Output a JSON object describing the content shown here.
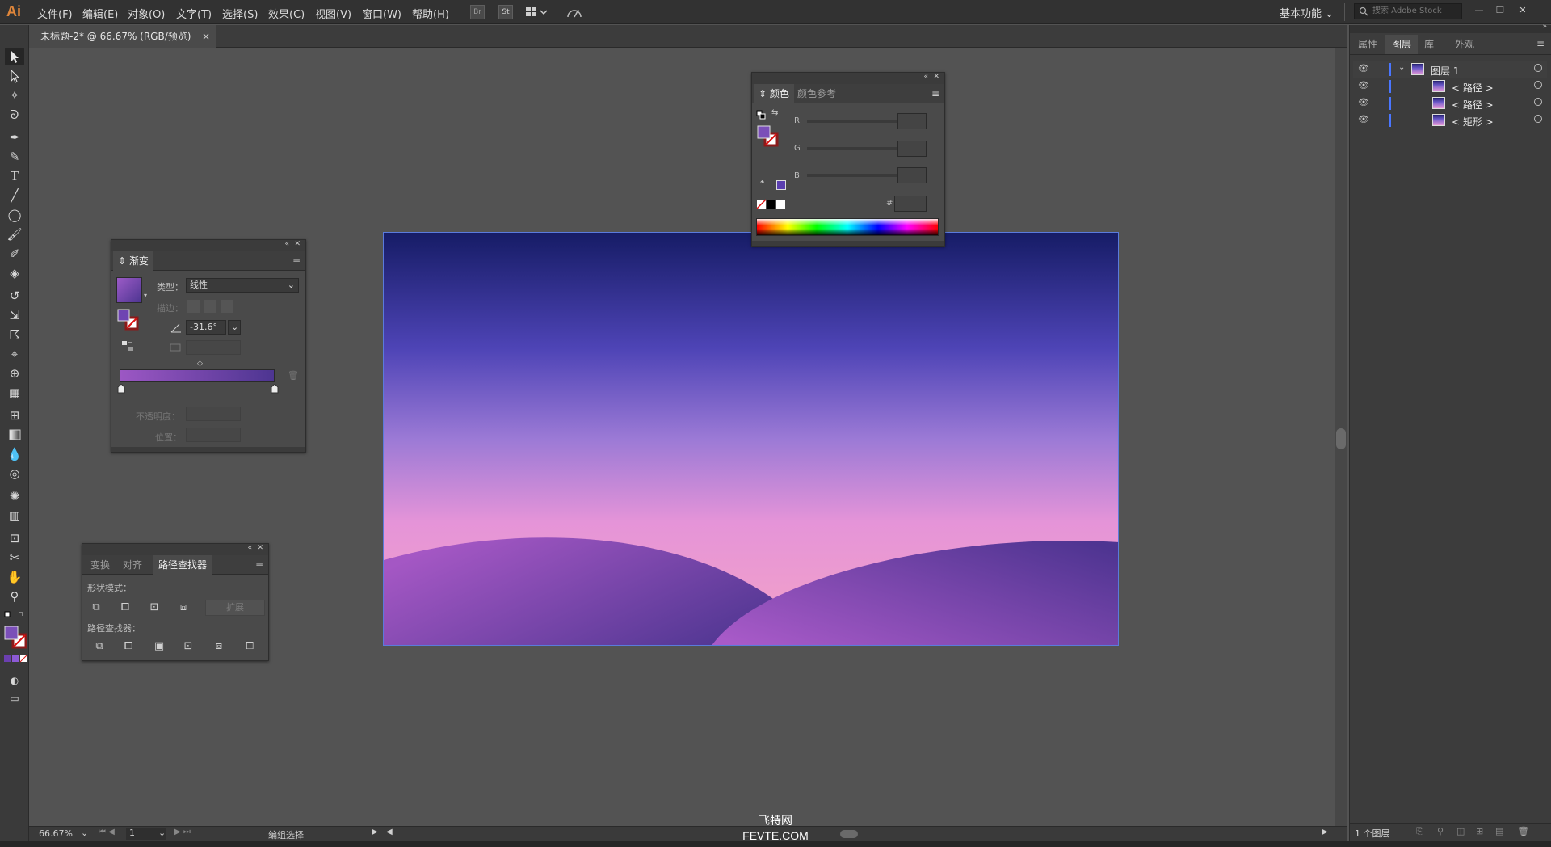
{
  "app": {
    "logo": "Ai"
  },
  "menu": [
    "文件(F)",
    "编辑(E)",
    "对象(O)",
    "文字(T)",
    "选择(S)",
    "效果(C)",
    "视图(V)",
    "窗口(W)",
    "帮助(H)"
  ],
  "menu_icons": {
    "bridge": "Br",
    "stock": "St"
  },
  "workspace": "基本功能",
  "search_placeholder": "搜索 Adobe Stock",
  "doc_tab": {
    "title": "未标题-2* @ 66.67% (RGB/预览)",
    "close": "×"
  },
  "tools": [
    "selection-arrow",
    "direct-selection",
    "magic-wand",
    "lasso",
    "pen",
    "curvature-pen",
    "type",
    "line-segment",
    "ellipse",
    "paintbrush",
    "shaper",
    "eraser",
    "rotate",
    "scale",
    "warp",
    "free-transform",
    "shape-builder",
    "perspective-grid",
    "mesh",
    "gradient",
    "eyedropper",
    "blend",
    "symbol-sprayer",
    "column-graph",
    "artboard",
    "slice",
    "hand",
    "zoom"
  ],
  "gradient_panel": {
    "tab": "渐变",
    "type_label": "类型：",
    "type_value": "线性",
    "stroke_label": "描边：",
    "angle_value": "-31.6°",
    "opacity_label": "不透明度：",
    "position_label": "位置："
  },
  "color_panel": {
    "tabs": [
      "颜色",
      "颜色参考"
    ],
    "channels": [
      "R",
      "G",
      "B"
    ],
    "hash": "#"
  },
  "pathfinder_panel": {
    "tabs": [
      "变换",
      "对齐",
      "路径查找器"
    ],
    "shape_modes_label": "形状模式：",
    "expand_label": "扩展",
    "pathfinders_label": "路径查找器："
  },
  "right_panel": {
    "tabs": [
      "属性",
      "图层",
      "库",
      "外观"
    ],
    "layers": [
      {
        "name": "图层 1"
      },
      {
        "name": "< 路径 >"
      },
      {
        "name": "< 路径 >"
      },
      {
        "name": "< 矩形 >"
      }
    ],
    "footer_count": "1 个图层"
  },
  "status": {
    "zoom": "66.67%",
    "page": "1",
    "mode": "编组选择"
  },
  "watermark": {
    "line1": "飞特网",
    "line2": "FEVTE.COM"
  },
  "colors": {
    "sky_top": "#161c66",
    "sky_mid": "#5a4ec4",
    "sky_pink": "#e594d8",
    "hill_light": "#a457c4",
    "hill_dark": "#4d3590",
    "accent_blue": "#4a76ff"
  }
}
